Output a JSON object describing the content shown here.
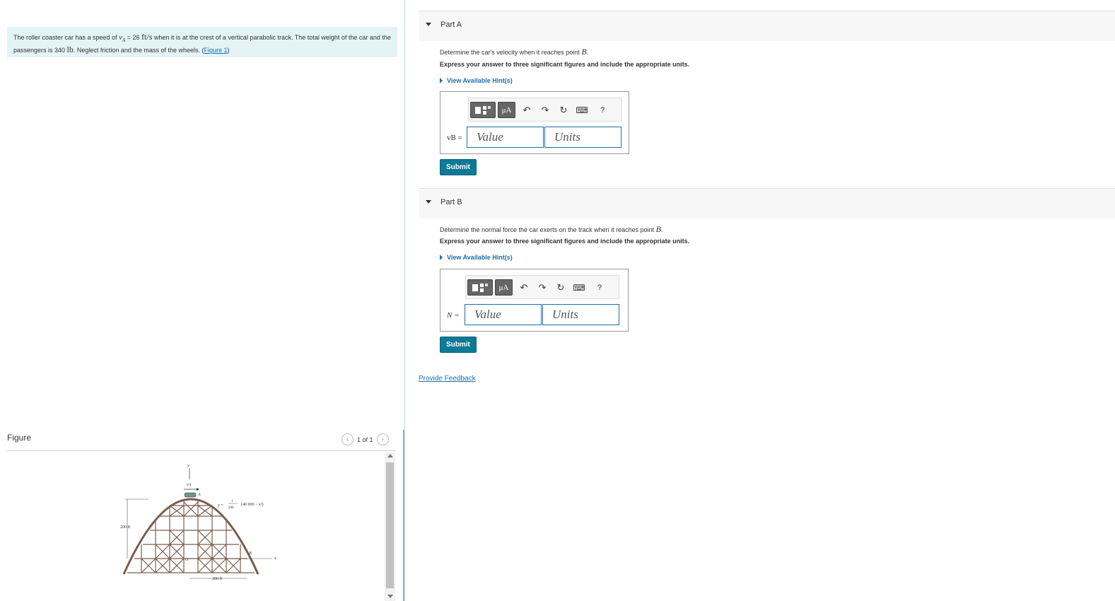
{
  "problem": {
    "text_1": "The roller coaster car has a speed of ",
    "speed_symbol": "v",
    "speed_subscript": "A",
    "speed_value": " = 26 ",
    "speed_unit": "ft/s",
    "text_2": " when it is at the crest of a vertical parabolic track. The total weight of the car and the passengers is 340 ",
    "weight_unit": "lb",
    "text_3": ". Neglect friction and the mass of the wheels. (",
    "figure_link": "Figure 1",
    "text_4": ")"
  },
  "figure": {
    "title": "Figure",
    "pagination": "1 of 1",
    "labels": {
      "y_axis": "y",
      "x_axis": "x",
      "velocity": "vA",
      "point_a": "A",
      "point_b": "B",
      "origin": "O",
      "height": "200 ft",
      "width": "200 ft",
      "equation_prefix": "y = ",
      "equation_num": "1",
      "equation_den": "200",
      "equation_body": "(40 000 − x²)"
    }
  },
  "part_a": {
    "header": "Part A",
    "question_prefix": "Determine the car's velocity when it reaches point ",
    "question_point": "B",
    "question_suffix": ".",
    "instruction": "Express your answer to three significant figures and include the appropriate units.",
    "hint": "View Available Hint(s)",
    "variable": "vB =",
    "value_placeholder": "Value",
    "units_placeholder": "Units",
    "submit": "Submit"
  },
  "part_b": {
    "header": "Part B",
    "question_prefix": "Determine the normal force the car exerts on the track when it reaches point ",
    "question_point": "B",
    "question_suffix": ".",
    "instruction": "Express your answer to three significant figures and include the appropriate units.",
    "hint": "View Available Hint(s)",
    "variable": "N =",
    "value_placeholder": "Value",
    "units_placeholder": "Units",
    "submit": "Submit"
  },
  "toolbar": {
    "mu_label": "μA",
    "undo_glyph": "↶",
    "redo_glyph": "↷",
    "reset_glyph": "↻",
    "keyboard_glyph": "⌨",
    "help_glyph": "?"
  },
  "feedback": "Provide Feedback",
  "colors": {
    "accent": "#0e7a96",
    "link": "#1a6faa",
    "problem_bg": "#e4f3f6",
    "track": "#7a5c4a"
  }
}
